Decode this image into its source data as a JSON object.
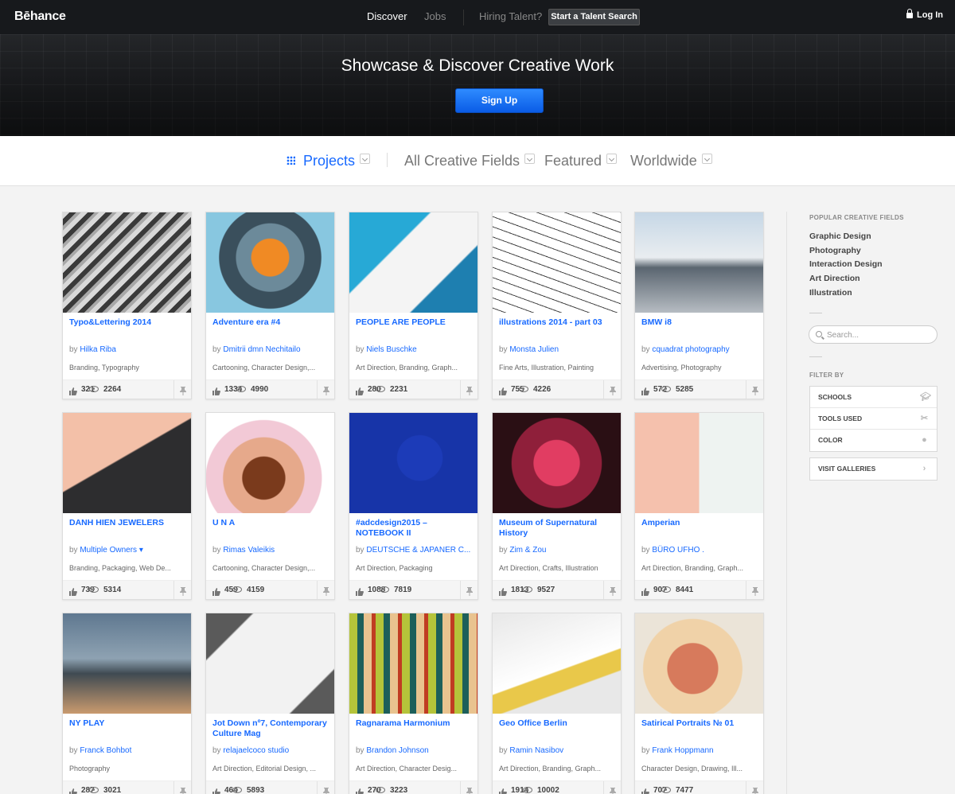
{
  "header": {
    "logo": "Bēhance",
    "nav": [
      "Discover",
      "Jobs"
    ],
    "hiring_label": "Hiring Talent?",
    "talent_button": "Start a Talent Search",
    "login": "Log In"
  },
  "hero": {
    "title": "Showcase & Discover Creative Work",
    "signup": "Sign Up"
  },
  "filters": [
    "Projects",
    "All Creative Fields",
    "Featured",
    "Worldwide"
  ],
  "sidebar": {
    "popular_heading": "POPULAR CREATIVE FIELDS",
    "popular": [
      "Graphic Design",
      "Photography",
      "Interaction Design",
      "Art Direction",
      "Illustration"
    ],
    "search_placeholder": "Search...",
    "filter_heading": "FILTER BY",
    "filter_by": [
      "SCHOOLS",
      "TOOLS USED",
      "COLOR"
    ],
    "galleries": "VISIT GALLERIES"
  },
  "projects": [
    {
      "title": "Typo&Lettering 2014",
      "by": "by",
      "owner": "Hilka Riba",
      "fields": "Branding, Typography",
      "appreciations": "321",
      "views": "2264"
    },
    {
      "title": "Adventure era #4",
      "by": "by",
      "owner": "Dmitrii dmn Nechitailo",
      "fields": "Cartooning, Character Design,...",
      "appreciations": "1334",
      "views": "4990"
    },
    {
      "title": "PEOPLE ARE PEOPLE",
      "by": "by",
      "owner": "Niels Buschke",
      "fields": "Art Direction, Branding, Graph...",
      "appreciations": "280",
      "views": "2231"
    },
    {
      "title": "illustrations 2014 - part 03",
      "by": "by",
      "owner": "Monsta Julien",
      "fields": "Fine Arts, Illustration, Painting",
      "appreciations": "755",
      "views": "4226"
    },
    {
      "title": "BMW i8",
      "by": "by",
      "owner": "cquadrat photography",
      "fields": "Advertising, Photography",
      "appreciations": "572",
      "views": "5285"
    },
    {
      "title": "DANH HIEN JEWELERS",
      "by": "by",
      "owner": "Multiple Owners",
      "fields": "Branding, Packaging, Web De...",
      "appreciations": "739",
      "views": "5314"
    },
    {
      "title": "U N A",
      "by": "by",
      "owner": "Rimas Valeikis",
      "fields": "Cartooning, Character Design,...",
      "appreciations": "459",
      "views": "4159"
    },
    {
      "title": "#adcdesign2015 – NOTEBOOK II",
      "by": "by",
      "owner": "DEUTSCHE & JAPANER C...",
      "fields": "Art Direction, Packaging",
      "appreciations": "1088",
      "views": "7819"
    },
    {
      "title": "Museum of Supernatural History",
      "by": "by",
      "owner": "Zim & Zou",
      "fields": "Art Direction, Crafts, Illustration",
      "appreciations": "1813",
      "views": "9527"
    },
    {
      "title": "Amperian",
      "by": "by",
      "owner": "BÜRO UFHO .",
      "fields": "Art Direction, Branding, Graph...",
      "appreciations": "907",
      "views": "8441"
    },
    {
      "title": "NY PLAY",
      "by": "by",
      "owner": "Franck Bohbot",
      "fields": "Photography",
      "appreciations": "287",
      "views": "3021"
    },
    {
      "title": "Jot Down nº7, Contemporary Culture Mag",
      "by": "by",
      "owner": "relajaelcoco studio",
      "fields": "Art Direction, Editorial Design, ...",
      "appreciations": "464",
      "views": "5893"
    },
    {
      "title": "Ragnarama Harmonium",
      "by": "by",
      "owner": "Brandon Johnson",
      "fields": "Art Direction, Character Desig...",
      "appreciations": "270",
      "views": "3223"
    },
    {
      "title": "Geo Office Berlin",
      "by": "by",
      "owner": "Ramin Nasibov",
      "fields": "Art Direction, Branding, Graph...",
      "appreciations": "1914",
      "views": "10002"
    },
    {
      "title": "Satirical Portraits № 01",
      "by": "by",
      "owner": "Frank Hoppmann",
      "fields": "Character Design, Drawing, Ill...",
      "appreciations": "707",
      "views": "7477"
    }
  ],
  "colors": {
    "accent": "#1769ff",
    "header_bg": "#17191c",
    "page_bg": "#f3f3f3"
  }
}
